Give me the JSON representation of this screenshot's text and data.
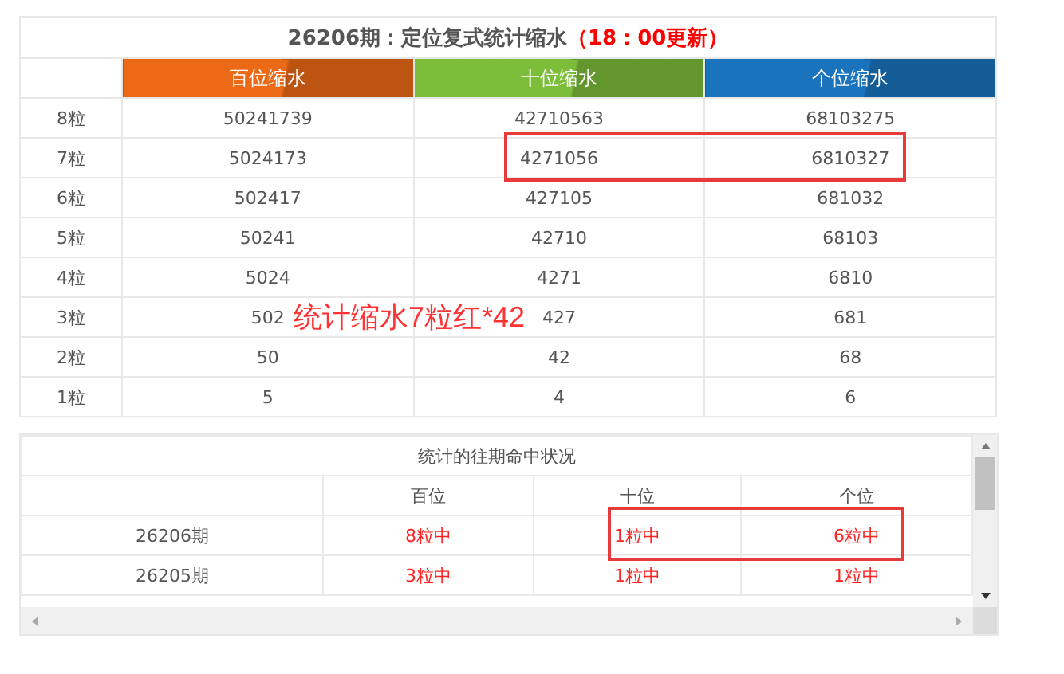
{
  "summary_table": {
    "title": "26206期：定位复式统计缩水",
    "title_note": "（18：00更新）",
    "columns": [
      {
        "label": "百位缩水",
        "color": "#ec6a16"
      },
      {
        "label": "十位缩水",
        "color": "#7cbd3a"
      },
      {
        "label": "个位缩水",
        "color": "#1a74bd"
      }
    ],
    "rows": [
      {
        "label": "8粒",
        "values": [
          "50241739",
          "42710563",
          "68103275"
        ]
      },
      {
        "label": "7粒",
        "values": [
          "5024173",
          "4271056",
          "6810327"
        ]
      },
      {
        "label": "6粒",
        "values": [
          "502417",
          "427105",
          "681032"
        ]
      },
      {
        "label": "5粒",
        "values": [
          "50241",
          "42710",
          "68103"
        ]
      },
      {
        "label": "4粒",
        "values": [
          "5024",
          "4271",
          "6810"
        ]
      },
      {
        "label": "3粒",
        "values": [
          "502",
          "427",
          "681"
        ]
      },
      {
        "label": "2粒",
        "values": [
          "50",
          "42",
          "68"
        ]
      },
      {
        "label": "1粒",
        "values": [
          "5",
          "4",
          "6"
        ]
      }
    ]
  },
  "annotation": "统计缩水7粒红*42",
  "history_table": {
    "title": "统计的往期命中状况",
    "columns": [
      "百位",
      "十位",
      "个位"
    ],
    "rows": [
      {
        "period": "26206期",
        "values": [
          "8粒中",
          "1粒中",
          "6粒中"
        ]
      },
      {
        "period": "26205期",
        "values": [
          "3粒中",
          "1粒中",
          "1粒中"
        ]
      }
    ]
  }
}
